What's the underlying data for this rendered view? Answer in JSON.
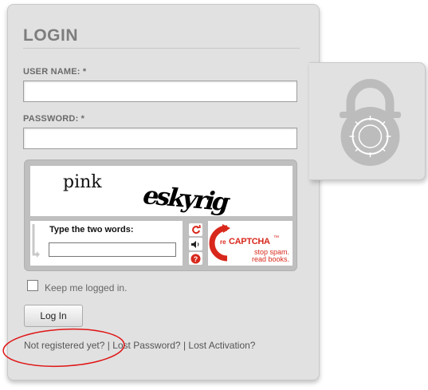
{
  "login": {
    "title": "LOGIN",
    "username_label": "USER NAME: *",
    "password_label": "PASSWORD: *",
    "keep_logged_in": "Keep me logged in.",
    "submit": "Log In"
  },
  "captcha": {
    "word1": "pink",
    "word2": "eskyrig",
    "prompt": "Type the two words:",
    "brand_re": "re",
    "brand_name": "CAPTCHA",
    "tm": "™",
    "tagline1": "stop spam.",
    "tagline2": "read books."
  },
  "links": {
    "register": "Not registered yet?",
    "lost_password": "Lost Password?",
    "lost_activation": "Lost Activation?",
    "separator": "|"
  },
  "colors": {
    "panel": "#e1e1e1",
    "lock": "#bcbcbc",
    "captcha_red": "#d8281c",
    "annotation_red": "#e01515"
  }
}
